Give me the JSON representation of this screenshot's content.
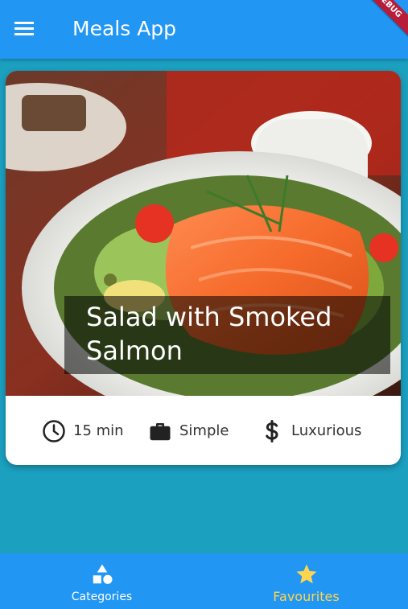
{
  "app_bar": {
    "title": "Meals App",
    "menu_icon": "menu-icon",
    "debug_banner": "DEBUG",
    "color": "#2196f3"
  },
  "meal_card": {
    "title": "Salad with Smoked Salmon",
    "duration": "15 min",
    "complexity": "Simple",
    "affordability": "Luxurious",
    "duration_icon": "clock-icon",
    "complexity_icon": "briefcase-icon",
    "affordability_icon": "dollar-icon"
  },
  "bottom_nav": {
    "items": [
      {
        "label": "Categories",
        "icon": "category-icon",
        "active": false
      },
      {
        "label": "Favourites",
        "icon": "star-icon",
        "active": true
      }
    ],
    "active_color": "#ffd54f"
  },
  "background_color": "#1ba0c0"
}
